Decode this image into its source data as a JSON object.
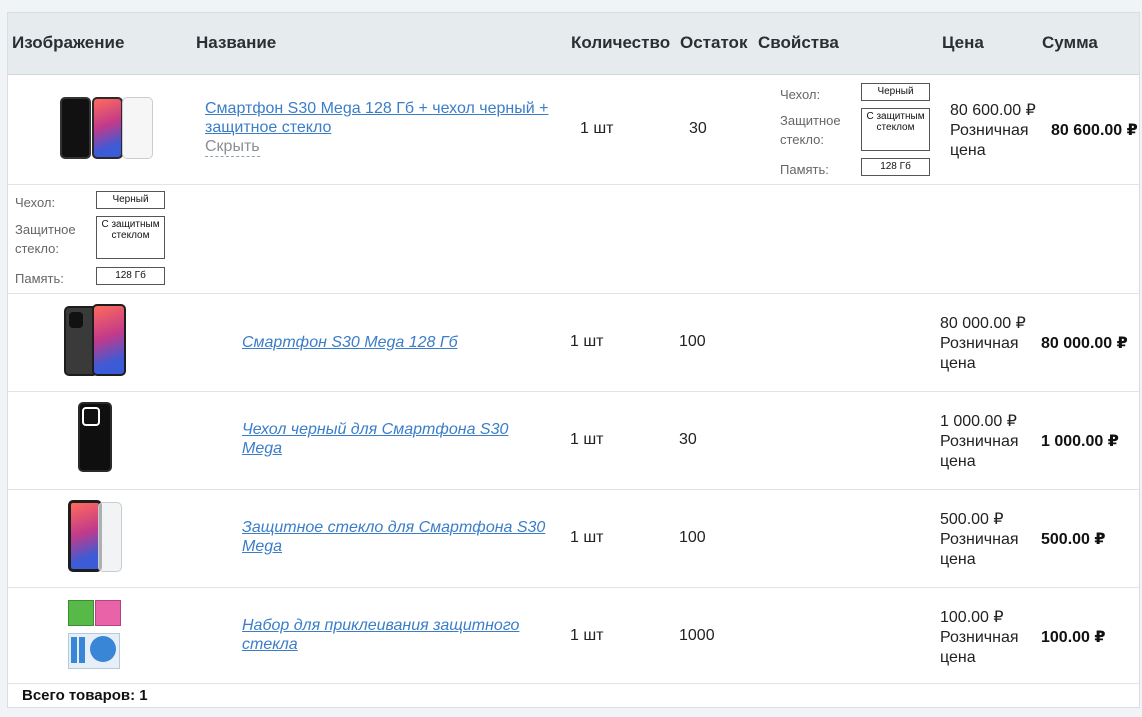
{
  "header": {
    "image": "Изображение",
    "name": "Название",
    "qty": "Количество",
    "stock": "Остаток",
    "props": "Свойства",
    "price": "Цена",
    "sum": "Сумма"
  },
  "main_item": {
    "title": "Смартфон S30 Mega 128 Гб + чехол черный + защитное стекло",
    "title_line1": "Смартфон S30 Mega 128 Гб + чехол черный +",
    "title_line2": "защитное стекло",
    "hide": "Скрыть",
    "qty": "1 шт",
    "stock": "30",
    "price": "80 600.00 ₽",
    "price_type": "Розничная цена",
    "sum": "80 600.00 ₽",
    "props": [
      {
        "label": "Чехол:",
        "value": "Черный"
      },
      {
        "label": "Защитное стекло:",
        "value": "С защитным стеклом"
      },
      {
        "label": "Память:",
        "value": "128 Гб"
      }
    ]
  },
  "sub_items": [
    {
      "name": "Смартфон S30 Mega 128 Гб",
      "qty": "1 шт",
      "stock": "100",
      "price": "80 000.00 ₽",
      "price_type": "Розничная цена",
      "sum": "80 000.00 ₽"
    },
    {
      "name": "Чехол черный для Смартфона S30 Mega",
      "qty": "1 шт",
      "stock": "30",
      "price": "1 000.00 ₽",
      "price_type": "Розничная цена",
      "sum": "1 000.00 ₽"
    },
    {
      "name": "Защитное стекло для Смартфона S30 Mega",
      "qty": "1 шт",
      "stock": "100",
      "price": "500.00 ₽",
      "price_type": "Розничная цена",
      "sum": "500.00 ₽"
    },
    {
      "name": "Набор для приклеивания защитного стекла",
      "qty": "1 шт",
      "stock": "1000",
      "price": "100.00 ₽",
      "price_type": "Розничная цена",
      "sum": "100.00 ₽"
    }
  ],
  "footer": {
    "total": "Всего товаров: 1"
  },
  "icons": {
    "bundle": "phone-bundle-image",
    "phone": "smartphone-image",
    "case": "phone-case-image",
    "glass": "screen-protector-image",
    "kit": "installation-kit-image"
  },
  "colors": {
    "link": "#3a7dc9",
    "header_bg": "#e6eced"
  }
}
